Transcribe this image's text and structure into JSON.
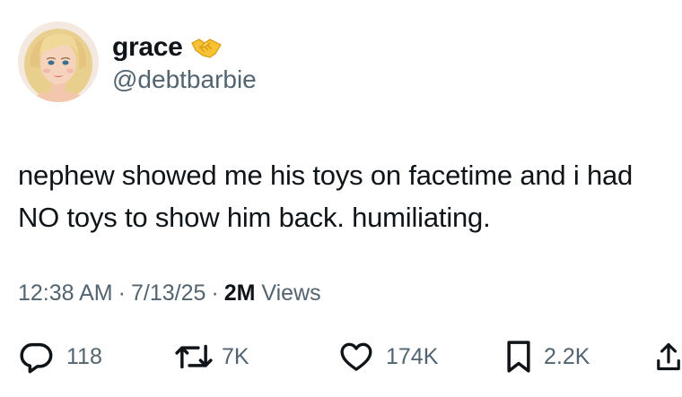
{
  "user": {
    "display_name": "grace",
    "badge_icon": "handshake-emoji",
    "handle": "@debtbarbie",
    "avatar": "blonde-doll-portrait"
  },
  "tweet": {
    "text": "nephew showed me his toys on facetime and i had NO toys to show him back. humiliating.",
    "time": "12:38 AM",
    "date": "7/13/25",
    "separator": "·",
    "views_count": "2M",
    "views_label": "Views"
  },
  "actions": {
    "replies": {
      "icon": "reply-icon",
      "count": "118"
    },
    "reposts": {
      "icon": "repost-icon",
      "count": "7K"
    },
    "likes": {
      "icon": "heart-icon",
      "count": "174K"
    },
    "bookmarks": {
      "icon": "bookmark-icon",
      "count": "2.2K"
    },
    "share": {
      "icon": "share-icon"
    }
  },
  "colors": {
    "text": "#0f1419",
    "secondary": "#536471",
    "background": "#ffffff"
  }
}
